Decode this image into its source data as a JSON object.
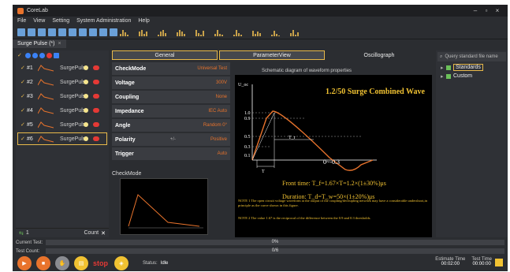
{
  "window": {
    "title": "CoreLab"
  },
  "menu": [
    "File",
    "View",
    "Setting",
    "System Administration",
    "Help"
  ],
  "doc_tab": {
    "title": "Surge Pulse (*)"
  },
  "channels": [
    {
      "id": "#1",
      "name": "SurgePulse"
    },
    {
      "id": "#2",
      "name": "SurgePulse"
    },
    {
      "id": "#3",
      "name": "SurgePulse"
    },
    {
      "id": "#4",
      "name": "SurgePulse"
    },
    {
      "id": "#5",
      "name": "SurgePulse"
    },
    {
      "id": "#6",
      "name": "SurgePulse",
      "selected": true
    }
  ],
  "left_footer": {
    "value": "1",
    "count_label": "Count"
  },
  "tabs": [
    {
      "label": "General",
      "state": "active"
    },
    {
      "label": "ParameterView",
      "state": "active"
    },
    {
      "label": "Oscillograph",
      "state": "plain"
    }
  ],
  "params": [
    {
      "key": "CheckMode",
      "value": "Universal Test"
    },
    {
      "key": "Voltage",
      "value": "300V"
    },
    {
      "key": "Coupling",
      "value": "None"
    },
    {
      "key": "Impedance",
      "value": "IEC Auto"
    },
    {
      "key": "Angle",
      "value": "Random 0°"
    },
    {
      "key": "Polarity",
      "mid": "+/-",
      "value": "Positive"
    },
    {
      "key": "Trigger",
      "value": "Auto"
    }
  ],
  "thumb_label": "CheckMode",
  "waveform": {
    "header": "Schematic diagram of waveform properties",
    "title": "1.2/50 Surge Combined Wave",
    "y_axis": "U_oc",
    "y_ticks": [
      "1.0",
      "0.9",
      "0.5",
      "0.3",
      "0.1"
    ],
    "x_labels": [
      "T",
      "T_r",
      "0~-0.3"
    ],
    "front_time": "Front time:  T_f=1.67×T=1.2×(1±30%)μs",
    "duration": "Duration:  T_d=T_w=50×(1±20%)μs",
    "note1": "NOTE 1 The open circuit voltage waveform at the output of the coupling/decoupling network may have a considerable undershoot,in principle as the curve shown in this figure.",
    "note2": "NOTE 2 The value 1.67 is the reciprocal of the difference between the 0.9 and 0.3 thresholds."
  },
  "right_panel": {
    "search_placeholder": "Query standard file name",
    "tree": [
      {
        "label": "Standards",
        "selected": true
      },
      {
        "label": "Custom",
        "selected": false
      }
    ]
  },
  "progress": {
    "current_test_label": "Current Test:",
    "current_test_value": "0%",
    "current_test_fraction": 0,
    "test_count_label": "Test Count:",
    "test_count_value": "0/6",
    "test_count_fraction": 0
  },
  "bottom": {
    "stop_label": "stop",
    "status_label": "Status:",
    "status_value": "Idle",
    "estimate_label": "Estimate Time",
    "estimate_value": "00:02:00",
    "test_time_label": "Test Time",
    "test_time_value": "00:00:00"
  },
  "colors": {
    "accent": "#e8732c",
    "selection": "#e8b94a",
    "panel": "#2b2d31"
  }
}
